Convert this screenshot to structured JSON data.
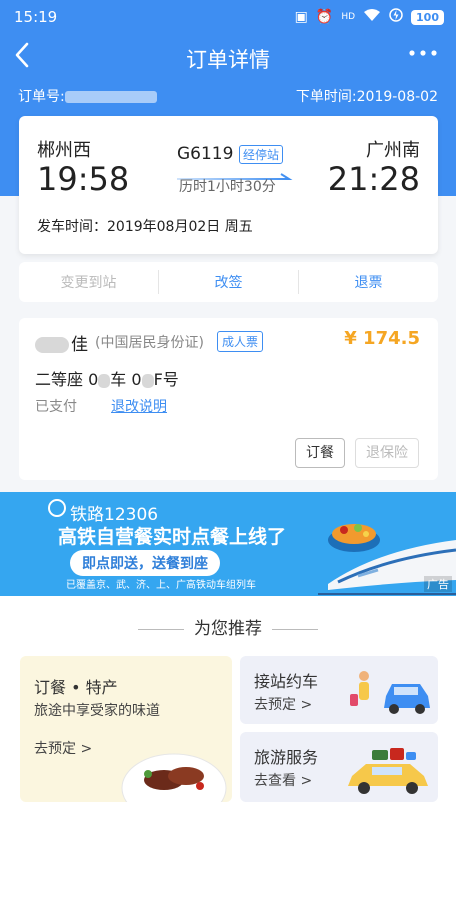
{
  "status_bar": {
    "time": "15:19",
    "battery": "100",
    "hd_label": "HD"
  },
  "nav": {
    "title": "订单详情",
    "back_icon": "chevron-left-icon",
    "more_icon": "more-dots-icon"
  },
  "order": {
    "number_label": "订单号:",
    "time_label": "下单时间:",
    "time_value": "2019-08-02"
  },
  "trip": {
    "from_station": "郴州西",
    "to_station": "广州南",
    "from_time": "19:58",
    "to_time": "21:28",
    "train_no": "G6119",
    "stop_badge": "经停站",
    "duration": "历时1小时30分",
    "depart_label": "发车时间：",
    "depart_value": "2019年08月02日 周五"
  },
  "actions": [
    {
      "label": "变更到站",
      "enabled": false
    },
    {
      "label": "改签",
      "enabled": true
    },
    {
      "label": "退票",
      "enabled": true
    }
  ],
  "passenger": {
    "name_tail": "佳",
    "id_type": "(中国居民身份证)",
    "ticket_type": "成人票",
    "price": "¥ 174.5",
    "seat_class": "二等座",
    "car_label": "车",
    "seat_label": "F号",
    "car_prefix": "0",
    "seat_prefix": "0",
    "paid": "已支付",
    "refund_info": "退改说明",
    "meal_button": "订餐",
    "insurance_button": "退保险"
  },
  "banner": {
    "logo": "铁路12306",
    "headline": "高铁自营餐实时点餐上线了",
    "pill": "即点即送，送餐到座",
    "cities": "已覆盖京、武、济、上、广高铁动车组列车",
    "ad": "广告"
  },
  "recommend": {
    "title": "为您推荐",
    "food": {
      "title": "订餐 • 特产",
      "subtitle": "旅途中享受家的味道",
      "cta": "去预定 >"
    },
    "car": {
      "title": "接站约车",
      "cta": "去预定 >"
    },
    "tour": {
      "title": "旅游服务",
      "cta": "去查看 >"
    }
  },
  "colors": {
    "brand": "#3e8ef2",
    "price": "#f5a623",
    "banner": "#35a6f0"
  }
}
